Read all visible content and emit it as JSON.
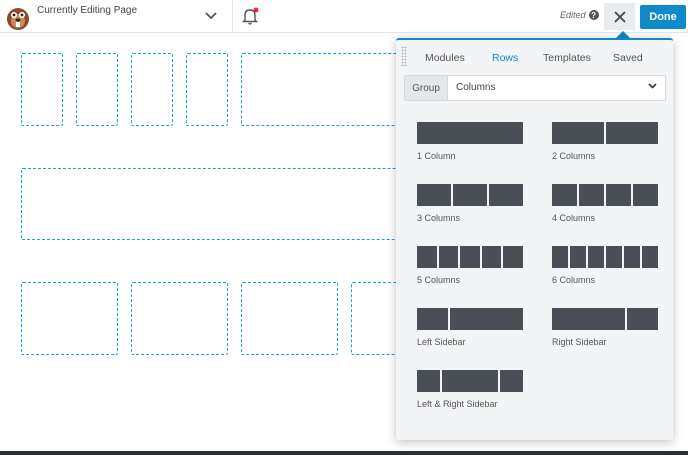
{
  "header": {
    "page_label": "Currently Editing Page",
    "edited_label": "Edited",
    "done_label": "Done",
    "logo_icon": "beaver-logo-icon",
    "notification_dot_color": "#d63638",
    "accent_color": "#0e8ac8"
  },
  "panel": {
    "tabs": [
      {
        "label": "Modules",
        "active": false
      },
      {
        "label": "Rows",
        "active": true
      },
      {
        "label": "Templates",
        "active": false
      },
      {
        "label": "Saved",
        "active": false
      }
    ],
    "group": {
      "label": "Group",
      "value": "Columns"
    },
    "layouts": [
      {
        "label": "1 Column"
      },
      {
        "label": "2 Columns"
      },
      {
        "label": "3 Columns"
      },
      {
        "label": "4 Columns"
      },
      {
        "label": "5 Columns"
      },
      {
        "label": "6 Columns"
      },
      {
        "label": "Left Sidebar"
      },
      {
        "label": "Right Sidebar"
      },
      {
        "label": "Left & Right Sidebar"
      }
    ]
  }
}
